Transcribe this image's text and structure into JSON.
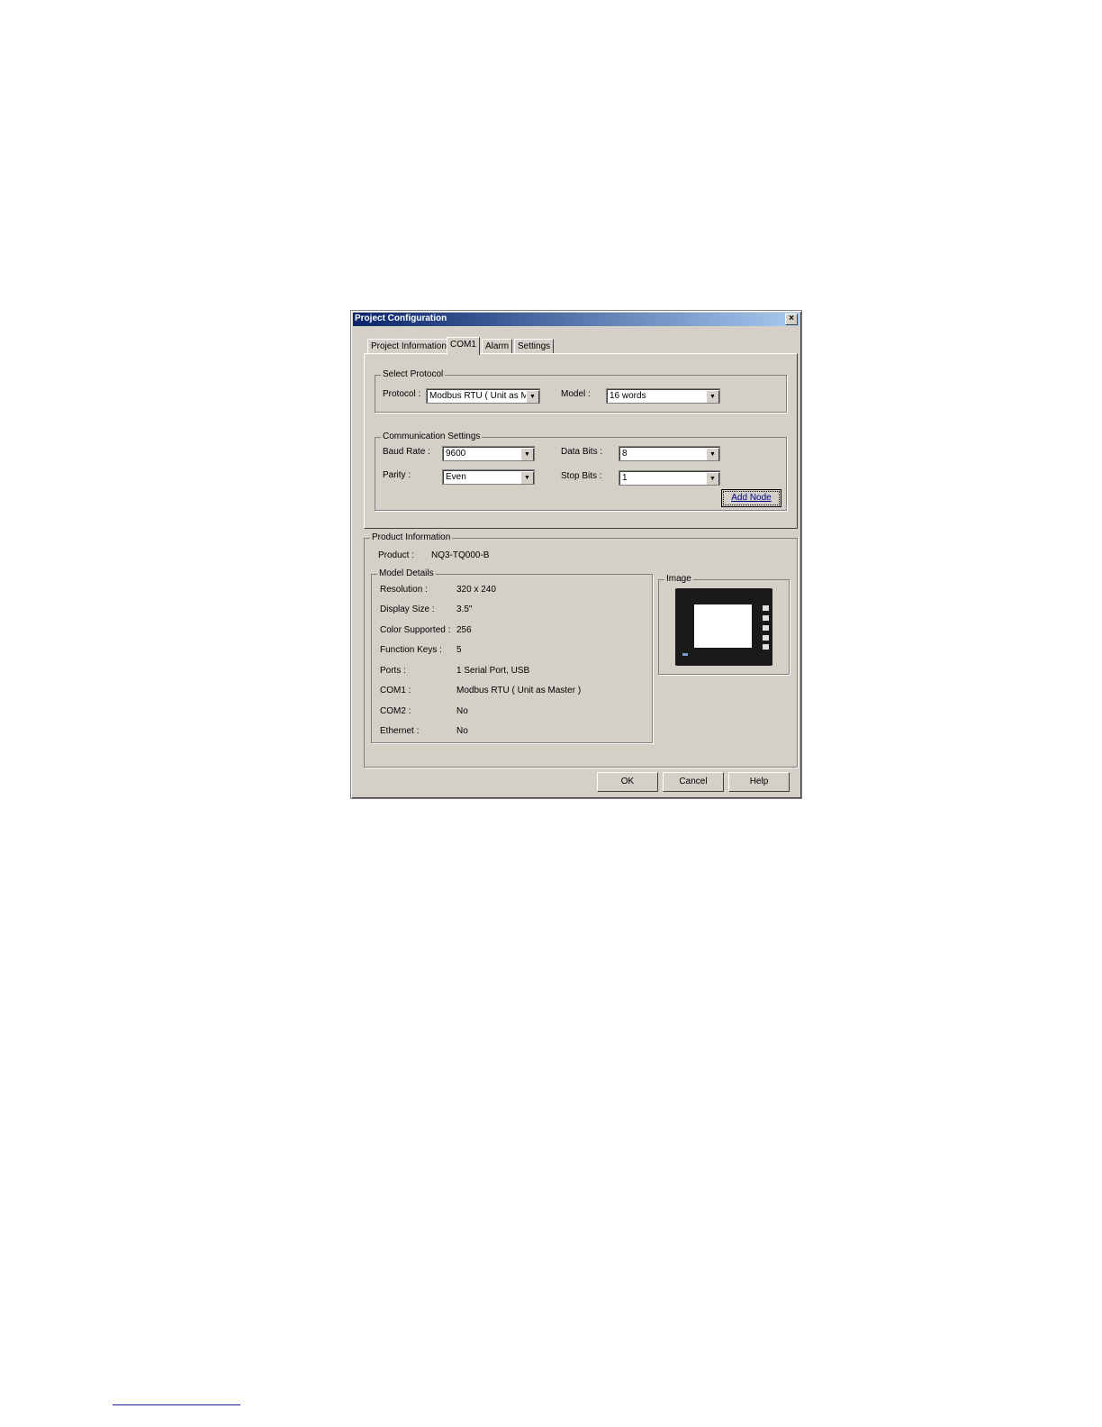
{
  "dialog": {
    "title": "Project Configuration",
    "close_glyph": "×"
  },
  "tabs": [
    {
      "label": "Project Information"
    },
    {
      "label": "COM1"
    },
    {
      "label": "Alarm"
    },
    {
      "label": "Settings"
    }
  ],
  "select_protocol": {
    "legend": "Select Protocol",
    "protocol_label": "Protocol :",
    "protocol_value": "Modbus RTU ( Unit as M...",
    "model_label": "Model :",
    "model_value": "16 words"
  },
  "comm_settings": {
    "legend": "Communication Settings",
    "baud_label": "Baud Rate :",
    "baud_value": "9600",
    "data_bits_label": "Data Bits :",
    "data_bits_value": "8",
    "parity_label": "Parity :",
    "parity_value": "Even",
    "stop_bits_label": "Stop Bits :",
    "stop_bits_value": "1",
    "add_node_label": "Add Node"
  },
  "product_info": {
    "legend": "Product Information",
    "product_label": "Product :",
    "product_value": "NQ3-TQ000-B",
    "model_details_legend": "Model Details",
    "image_legend": "Image",
    "details": [
      {
        "label": "Resolution :",
        "value": "320 x 240"
      },
      {
        "label": "Display Size :",
        "value": "3.5\""
      },
      {
        "label": "Color Supported :",
        "value": "256"
      },
      {
        "label": "Function Keys :",
        "value": "5"
      },
      {
        "label": "Ports :",
        "value": "1 Serial Port, USB"
      },
      {
        "label": "COM1 :",
        "value": "Modbus RTU ( Unit as Master )"
      },
      {
        "label": "COM2 :",
        "value": "No"
      },
      {
        "label": "Ethernet :",
        "value": "No"
      }
    ]
  },
  "buttons": {
    "ok": "OK",
    "cancel": "Cancel",
    "help": "Help"
  },
  "icons": {
    "dropdown": "chevron-down-icon",
    "close": "close-icon"
  },
  "colors": {
    "title_start": "#0a246a",
    "title_end": "#a6caf0",
    "dialog_face": "#d4d0c8"
  }
}
